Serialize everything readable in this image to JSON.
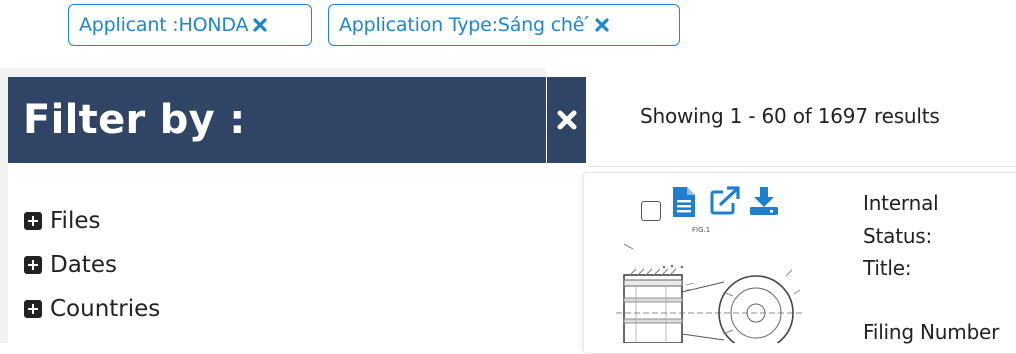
{
  "active_filters": [
    {
      "label": "Applicant :HONDA"
    },
    {
      "label": "Application Type:Sáng chê ́"
    }
  ],
  "filter_panel": {
    "title": "Filter by :",
    "sections": [
      {
        "label": "Files"
      },
      {
        "label": "Dates"
      },
      {
        "label": "Countries"
      }
    ]
  },
  "results": {
    "summary": "Showing 1 - 60 of 1697 results",
    "thumbnail_caption": "FIG.1",
    "first_result": {
      "fields": [
        "Internal",
        "Status:",
        "Title:",
        "Filing Number"
      ]
    }
  },
  "colors": {
    "chip_blue": "#1f86d6",
    "panel_navy": "#304566",
    "icon_blue": "#1e7fcf"
  }
}
